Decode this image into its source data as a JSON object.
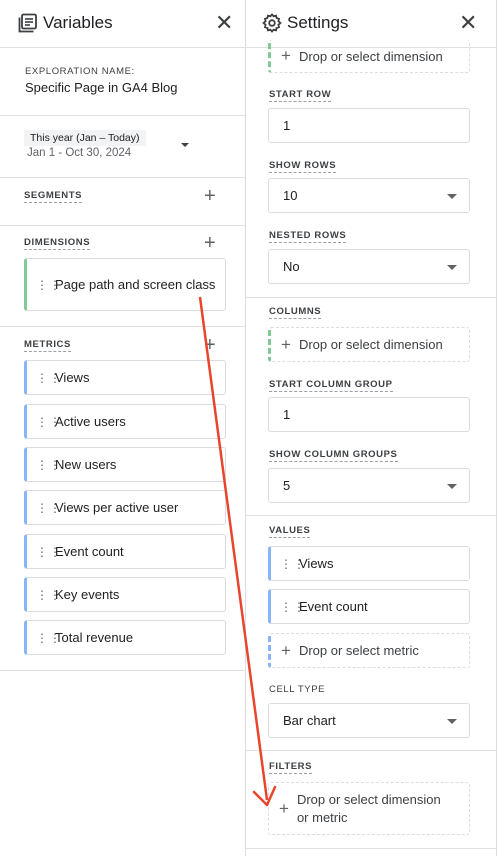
{
  "variables": {
    "title": "Variables",
    "exploration_label": "EXPLORATION NAME:",
    "exploration_name": "Specific Page in GA4 Blog",
    "date_preset": "This year (Jan – Today)",
    "date_range": "Jan 1 - Oct 30, 2024",
    "segments_label": "SEGMENTS",
    "dimensions_label": "DIMENSIONS",
    "dimensions": [
      "Page path and screen class"
    ],
    "metrics_label": "METRICS",
    "metrics": [
      "Views",
      "Active users",
      "New users",
      "Views per active user",
      "Event count",
      "Key events",
      "Total revenue"
    ]
  },
  "settings": {
    "title": "Settings",
    "rows_drop": "Drop or select dimension",
    "start_row_label": "START ROW",
    "start_row": "1",
    "show_rows_label": "SHOW ROWS",
    "show_rows": "10",
    "nested_rows_label": "NESTED ROWS",
    "nested_rows": "No",
    "columns_label": "COLUMNS",
    "columns_drop": "Drop or select dimension",
    "start_col_label": "START COLUMN GROUP",
    "start_col": "1",
    "show_col_label": "SHOW COLUMN GROUPS",
    "show_col": "5",
    "values_label": "VALUES",
    "values": [
      "Views",
      "Event count"
    ],
    "values_drop": "Drop or select metric",
    "cell_type_label": "CELL TYPE",
    "cell_type": "Bar chart",
    "filters_label": "FILTERS",
    "filters_drop_line1": "Drop or select dimension",
    "filters_drop_line2": "or metric"
  },
  "colors": {
    "arrow": "#e8452c",
    "dimension_accent": "#81c995",
    "metric_accent": "#8ab4f8"
  }
}
